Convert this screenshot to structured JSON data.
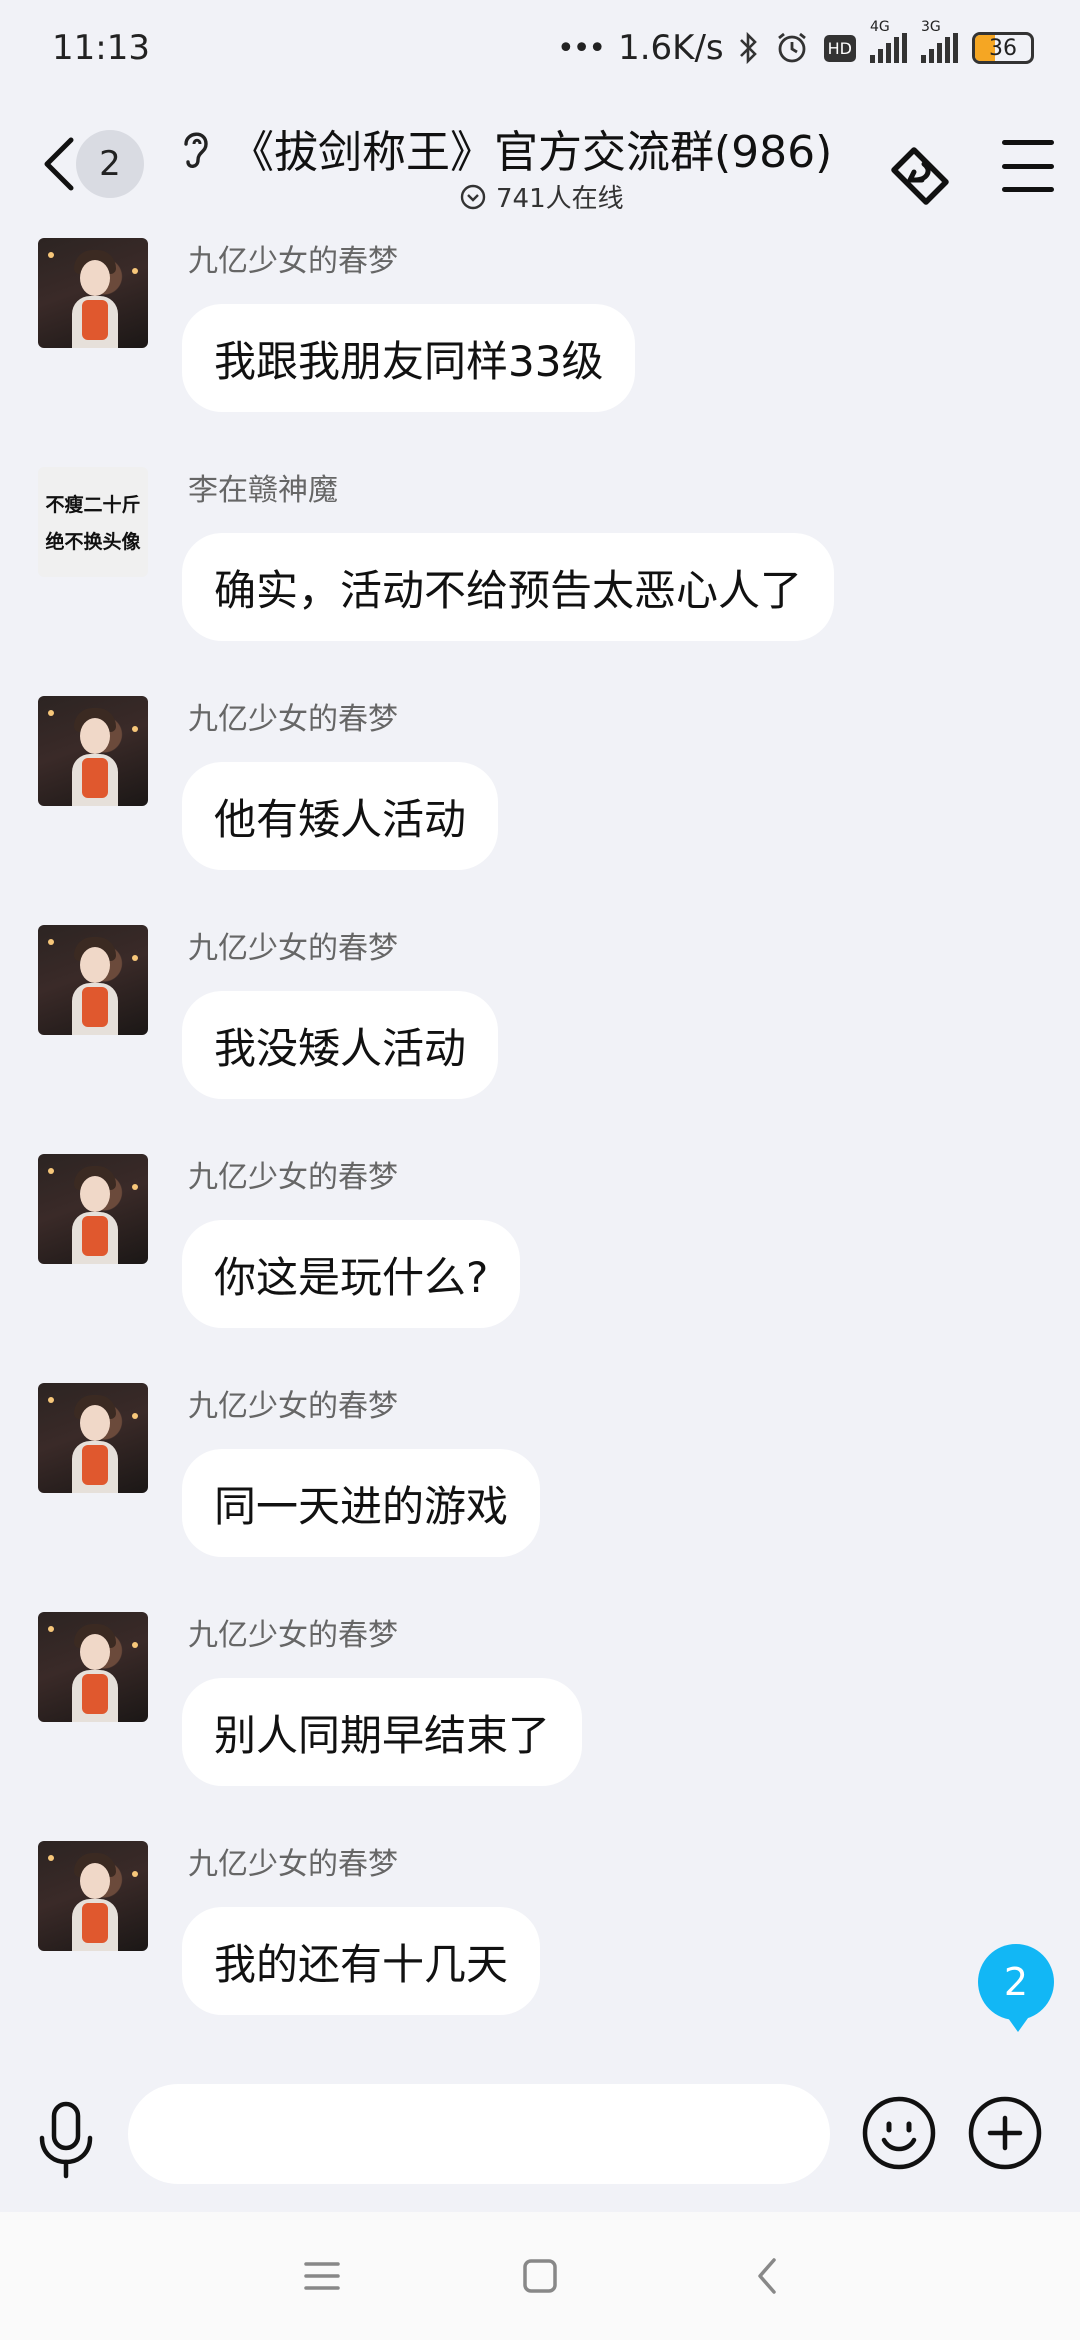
{
  "status_bar": {
    "time": "11:13",
    "net_speed": "1.6K/s",
    "hd_label": "HD",
    "sim1_label": "4G",
    "sim2_label": "3G",
    "battery": "36",
    "icons": [
      "dots-icon",
      "bluetooth-icon",
      "alarm-icon",
      "hd-icon",
      "signal-4g-icon",
      "signal-3g-icon",
      "battery-icon"
    ]
  },
  "header": {
    "back_count": "2",
    "title": "《拔剑称王》官方交流群(986)",
    "online": "741人在线"
  },
  "messages": [
    {
      "sender": "九亿少女的春梦",
      "text": "我跟我朋友同样33级",
      "avatar": "anime"
    },
    {
      "sender": "李在赣神魔",
      "text": "确实，活动不给预告太恶心人了",
      "avatar": "text",
      "avatar_lines": [
        "不瘦二十斤",
        "绝不换头像"
      ]
    },
    {
      "sender": "九亿少女的春梦",
      "text": "他有矮人活动",
      "avatar": "anime"
    },
    {
      "sender": "九亿少女的春梦",
      "text": "我没矮人活动",
      "avatar": "anime"
    },
    {
      "sender": "九亿少女的春梦",
      "text": "你这是玩什么?",
      "avatar": "anime"
    },
    {
      "sender": "九亿少女的春梦",
      "text": "同一天进的游戏",
      "avatar": "anime"
    },
    {
      "sender": "九亿少女的春梦",
      "text": "别人同期早结束了",
      "avatar": "anime"
    },
    {
      "sender": "九亿少女的春梦",
      "text": "我的还有十几天",
      "avatar": "anime"
    }
  ],
  "new_message_badge": "2",
  "input": {
    "value": "",
    "placeholder": ""
  },
  "colors": {
    "accent": "#12b7f5",
    "background": "#f1f2f7",
    "bubble": "#ffffff"
  }
}
